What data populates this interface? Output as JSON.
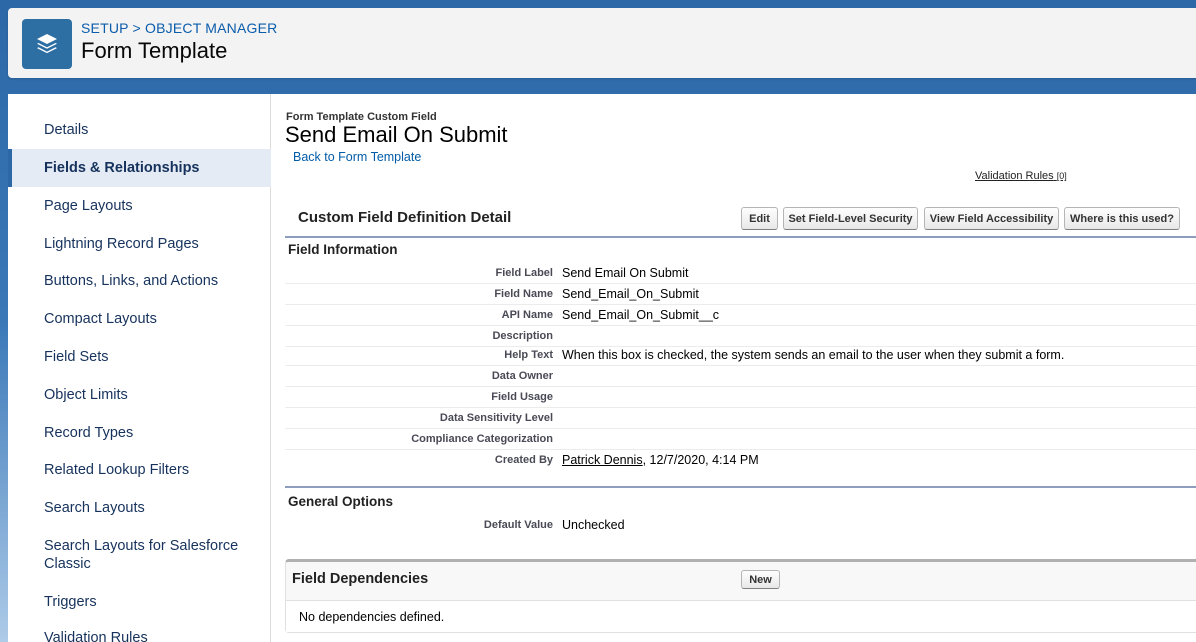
{
  "header": {
    "breadcrumb_setup": "SETUP",
    "breadcrumb_sep": ">",
    "breadcrumb_object_manager": "OBJECT MANAGER",
    "title": "Form Template",
    "icon": "layers-icon"
  },
  "sidebar": {
    "items": [
      {
        "label": "Details"
      },
      {
        "label": "Fields & Relationships"
      },
      {
        "label": "Page Layouts"
      },
      {
        "label": "Lightning Record Pages"
      },
      {
        "label": "Buttons, Links, and Actions"
      },
      {
        "label": "Compact Layouts"
      },
      {
        "label": "Field Sets"
      },
      {
        "label": "Object Limits"
      },
      {
        "label": "Record Types"
      },
      {
        "label": "Related Lookup Filters"
      },
      {
        "label": "Search Layouts"
      },
      {
        "label": "Search Layouts for Salesforce Classic"
      },
      {
        "label": "Triggers"
      },
      {
        "label": "Validation Rules"
      }
    ],
    "active_index": 1
  },
  "content": {
    "eyebrow": "Form Template Custom Field",
    "title": "Send Email On Submit",
    "back_link": "Back to Form Template",
    "validation_rules_link": "Validation Rules",
    "validation_rules_count": "[0]",
    "section_title": "Custom Field Definition Detail",
    "buttons": {
      "edit": "Edit",
      "fls": "Set Field-Level Security",
      "accessibility": "View Field Accessibility",
      "where_used": "Where is this used?"
    },
    "field_info": {
      "heading": "Field Information",
      "rows": [
        {
          "label": "Field Label",
          "value": "Send Email On Submit"
        },
        {
          "label": "Field Name",
          "value": "Send_Email_On_Submit"
        },
        {
          "label": "API Name",
          "value": "Send_Email_On_Submit__c"
        },
        {
          "label": "Description",
          "value": ""
        },
        {
          "label": "Help Text",
          "value": "When this box is checked, the system sends an email to the user when they submit a form."
        },
        {
          "label": "Data Owner",
          "value": ""
        },
        {
          "label": "Field Usage",
          "value": ""
        },
        {
          "label": "Data Sensitivity Level",
          "value": ""
        },
        {
          "label": "Compliance Categorization",
          "value": ""
        }
      ],
      "created_by_label": "Created By",
      "created_by_name": "Patrick Dennis",
      "created_by_date": ", 12/7/2020, 4:14 PM"
    },
    "general_options": {
      "heading": "General Options",
      "default_label": "Default Value",
      "default_value": "Unchecked"
    },
    "dependencies": {
      "heading": "Field Dependencies",
      "new_button": "New",
      "empty_text": "No dependencies defined."
    }
  }
}
